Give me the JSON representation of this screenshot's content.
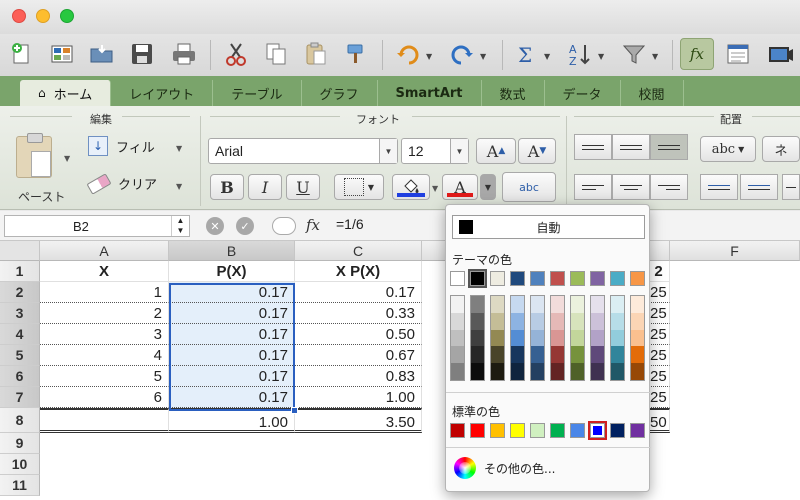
{
  "colors": {
    "ribbon_tab_bar": "#7aa46b",
    "selection": "#2a5fc0",
    "fill_underline": "#1f3fe0",
    "font_underline": "#e01a1a"
  },
  "toolbar": {
    "icons": [
      "new-document-icon",
      "gallery-icon",
      "open-folder-icon",
      "save-icon",
      "print-icon",
      "cut-icon",
      "copy-icon",
      "paste-icon",
      "format-painter-icon",
      "undo-icon",
      "redo-icon",
      "autosum-icon",
      "sort-icon",
      "filter-icon",
      "formula-builder-icon",
      "toolbox-icon",
      "media-icon"
    ],
    "fx_label": "fx"
  },
  "ribbon_tabs": [
    "ホーム",
    "レイアウト",
    "テーブル",
    "グラフ",
    "SmartArt",
    "数式",
    "データ",
    "校閲"
  ],
  "ribbon": {
    "edit_group_title": "編集",
    "font_group_title": "フォント",
    "align_group_title": "配置",
    "paste_label": "ペースト",
    "fill_label": "フィル",
    "clear_label": "クリア",
    "font_name": "Arial",
    "font_size": "12",
    "grow_label": "A",
    "shrink_label": "A",
    "bold_label": "B",
    "italic_label": "I",
    "underline_label": "U",
    "font_color_label": "A",
    "abc_label": "abc",
    "wrap_label": "abc",
    "partial_label": "ネ"
  },
  "formula_bar": {
    "cell_ref": "B2",
    "fx": "fx",
    "formula": "=1/6"
  },
  "sheet": {
    "columns": [
      "A",
      "B",
      "C",
      "D",
      "E",
      "F"
    ],
    "rows": [
      "1",
      "2",
      "3",
      "4",
      "5",
      "6",
      "7",
      "8",
      "9",
      "10",
      "11"
    ],
    "header_row": [
      "X",
      "P(X)",
      "X P(X)"
    ],
    "data": [
      [
        "1",
        "0.17",
        "0.17"
      ],
      [
        "2",
        "0.17",
        "0.33"
      ],
      [
        "3",
        "0.17",
        "0.50"
      ],
      [
        "4",
        "0.17",
        "0.67"
      ],
      [
        "5",
        "0.17",
        "0.83"
      ],
      [
        "6",
        "0.17",
        "1.00"
      ]
    ],
    "total_row": [
      "",
      "1.00",
      "3.50"
    ],
    "hidden_col_header_fragment": "2",
    "hidden_col_values": [
      "25",
      "25",
      "25",
      "25",
      "25",
      "25"
    ],
    "hidden_total_fragment": "50"
  },
  "color_popup": {
    "auto_label": "自動",
    "theme_label": "テーマの色",
    "standard_label": "標準の色",
    "other_label": "その他の色...",
    "theme_colors": [
      "#ffffff",
      "#000000",
      "#eeece1",
      "#1f497d",
      "#4f81bd",
      "#c0504d",
      "#9bbb59",
      "#8064a2",
      "#4bacc6",
      "#f79646"
    ],
    "theme_tints": [
      [
        "#f2f2f2",
        "#d8d8d8",
        "#bfbfbf",
        "#a5a5a5",
        "#7f7f7f"
      ],
      [
        "#7f7f7f",
        "#595959",
        "#3f3f3f",
        "#262626",
        "#0c0c0c"
      ],
      [
        "#ddd9c3",
        "#c4bd97",
        "#938953",
        "#494429",
        "#1d1b10"
      ],
      [
        "#c6d9f0",
        "#8db3e2",
        "#548dd4",
        "#17365d",
        "#0f243e"
      ],
      [
        "#dbe5f1",
        "#b8cce4",
        "#95b3d7",
        "#366092",
        "#244061"
      ],
      [
        "#f2dcdb",
        "#e5b9b7",
        "#d99694",
        "#953734",
        "#632423"
      ],
      [
        "#ebf1dd",
        "#d7e3bc",
        "#c3d69b",
        "#76923c",
        "#4f6128"
      ],
      [
        "#e5e0ec",
        "#ccc1d9",
        "#b2a2c7",
        "#5f497a",
        "#3f3151"
      ],
      [
        "#dbeef3",
        "#b7dde8",
        "#92cddc",
        "#31859b",
        "#205867"
      ],
      [
        "#fdeada",
        "#fbd5b5",
        "#fac08f",
        "#e36c09",
        "#974806"
      ]
    ],
    "standard_colors": [
      "#c00000",
      "#ff0000",
      "#ffc000",
      "#ffff00",
      "#d0f0c0",
      "#00b050",
      "#4a86e8",
      "#0000ff",
      "#002060",
      "#7030a0"
    ],
    "selected_standard_index": 7
  }
}
